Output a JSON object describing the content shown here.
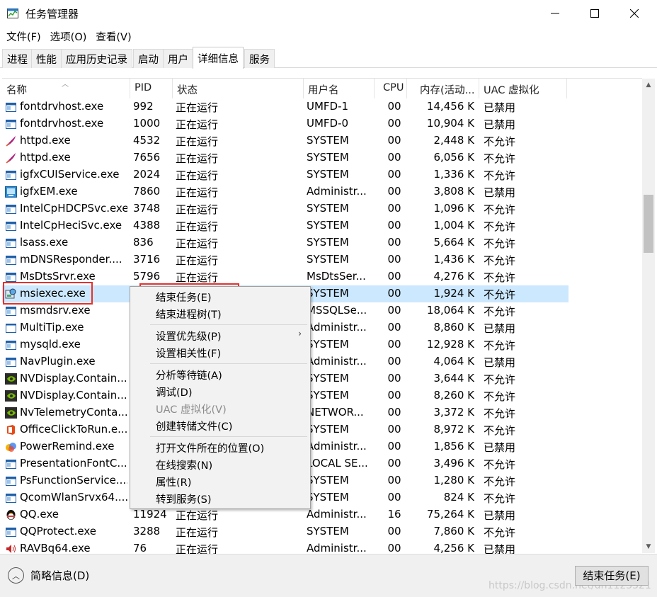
{
  "window": {
    "title": "任务管理器",
    "minimize_glyph": "—",
    "maximize_glyph": "☐",
    "close_glyph": "✕"
  },
  "menu": [
    "文件(F)",
    "选项(O)",
    "查看(V)"
  ],
  "tabs": [
    {
      "label": "进程",
      "active": false
    },
    {
      "label": "性能",
      "active": false
    },
    {
      "label": "应用历史记录",
      "active": false
    },
    {
      "label": "启动",
      "active": false
    },
    {
      "label": "用户",
      "active": false
    },
    {
      "label": "详细信息",
      "active": true
    },
    {
      "label": "服务",
      "active": false
    }
  ],
  "columns": {
    "name": "名称",
    "pid": "PID",
    "status": "状态",
    "user": "用户名",
    "cpu": "CPU",
    "memory": "内存(活动...",
    "uac": "UAC 虚拟化"
  },
  "rows": [
    {
      "name": "fontdrvhost.exe",
      "pid": "992",
      "status": "正在运行",
      "user": "UMFD-1",
      "cpu": "00",
      "memory": "14,456 K",
      "uac": "已禁用",
      "icon": "generic-window-icon"
    },
    {
      "name": "fontdrvhost.exe",
      "pid": "1000",
      "status": "正在运行",
      "user": "UMFD-0",
      "cpu": "00",
      "memory": "10,904 K",
      "uac": "已禁用",
      "icon": "generic-window-icon"
    },
    {
      "name": "httpd.exe",
      "pid": "4532",
      "status": "正在运行",
      "user": "SYSTEM",
      "cpu": "00",
      "memory": "2,448 K",
      "uac": "不允许",
      "icon": "apache-feather-icon"
    },
    {
      "name": "httpd.exe",
      "pid": "7656",
      "status": "正在运行",
      "user": "SYSTEM",
      "cpu": "00",
      "memory": "6,056 K",
      "uac": "不允许",
      "icon": "apache-feather-icon"
    },
    {
      "name": "igfxCUIService.exe",
      "pid": "2024",
      "status": "正在运行",
      "user": "SYSTEM",
      "cpu": "00",
      "memory": "1,336 K",
      "uac": "不允许",
      "icon": "generic-window-icon"
    },
    {
      "name": "igfxEM.exe",
      "pid": "7860",
      "status": "正在运行",
      "user": "Administr...",
      "cpu": "00",
      "memory": "3,808 K",
      "uac": "已禁用",
      "icon": "intel-graphics-icon"
    },
    {
      "name": "IntelCpHDCPSvc.exe",
      "pid": "3748",
      "status": "正在运行",
      "user": "SYSTEM",
      "cpu": "00",
      "memory": "1,096 K",
      "uac": "不允许",
      "icon": "generic-window-icon"
    },
    {
      "name": "IntelCpHeciSvc.exe",
      "pid": "4388",
      "status": "正在运行",
      "user": "SYSTEM",
      "cpu": "00",
      "memory": "1,004 K",
      "uac": "不允许",
      "icon": "generic-window-icon"
    },
    {
      "name": "lsass.exe",
      "pid": "836",
      "status": "正在运行",
      "user": "SYSTEM",
      "cpu": "00",
      "memory": "5,664 K",
      "uac": "不允许",
      "icon": "generic-window-icon"
    },
    {
      "name": "mDNSResponder....",
      "pid": "3716",
      "status": "正在运行",
      "user": "SYSTEM",
      "cpu": "00",
      "memory": "1,436 K",
      "uac": "不允许",
      "icon": "generic-window-icon"
    },
    {
      "name": "MsDtsSrvr.exe",
      "pid": "5796",
      "status": "正在运行",
      "user": "MsDtsSer...",
      "cpu": "00",
      "memory": "4,276 K",
      "uac": "不允许",
      "icon": "generic-window-icon"
    },
    {
      "name": "msiexec.exe",
      "pid": "",
      "status": "",
      "user": "SYSTEM",
      "cpu": "00",
      "memory": "1,924 K",
      "uac": "不允许",
      "icon": "installer-icon",
      "selected": true
    },
    {
      "name": "msmdsrv.exe",
      "pid": "",
      "status": "",
      "user": "MSSQLSe...",
      "cpu": "00",
      "memory": "18,064 K",
      "uac": "不允许",
      "icon": "generic-window-icon"
    },
    {
      "name": "MultiTip.exe",
      "pid": "",
      "status": "",
      "user": "Administr...",
      "cpu": "00",
      "memory": "8,860 K",
      "uac": "已禁用",
      "icon": "blank-window-icon"
    },
    {
      "name": "mysqld.exe",
      "pid": "",
      "status": "",
      "user": "SYSTEM",
      "cpu": "00",
      "memory": "12,928 K",
      "uac": "不允许",
      "icon": "generic-window-icon"
    },
    {
      "name": "NavPlugin.exe",
      "pid": "",
      "status": "",
      "user": "Administr...",
      "cpu": "00",
      "memory": "4,064 K",
      "uac": "已禁用",
      "icon": "generic-window-icon"
    },
    {
      "name": "NVDisplay.Contain...",
      "pid": "",
      "status": "",
      "user": "SYSTEM",
      "cpu": "00",
      "memory": "3,644 K",
      "uac": "不允许",
      "icon": "nvidia-icon"
    },
    {
      "name": "NVDisplay.Contain...",
      "pid": "",
      "status": "",
      "user": "SYSTEM",
      "cpu": "00",
      "memory": "8,260 K",
      "uac": "不允许",
      "icon": "nvidia-icon"
    },
    {
      "name": "NvTelemetryConta...",
      "pid": "",
      "status": "",
      "user": "NETWOR...",
      "cpu": "00",
      "memory": "3,372 K",
      "uac": "不允许",
      "icon": "nvidia-icon"
    },
    {
      "name": "OfficeClickToRun.e...",
      "pid": "",
      "status": "",
      "user": "SYSTEM",
      "cpu": "00",
      "memory": "8,972 K",
      "uac": "不允许",
      "icon": "office-icon"
    },
    {
      "name": "PowerRemind.exe",
      "pid": "",
      "status": "",
      "user": "Administr...",
      "cpu": "00",
      "memory": "1,856 K",
      "uac": "已禁用",
      "icon": "power-remind-icon"
    },
    {
      "name": "PresentationFontC...",
      "pid": "",
      "status": "",
      "user": "LOCAL SE...",
      "cpu": "00",
      "memory": "3,496 K",
      "uac": "不允许",
      "icon": "generic-window-icon"
    },
    {
      "name": "PsFunctionService....",
      "pid": "",
      "status": "",
      "user": "SYSTEM",
      "cpu": "00",
      "memory": "1,280 K",
      "uac": "不允许",
      "icon": "generic-window-icon"
    },
    {
      "name": "QcomWlanSrvx64....",
      "pid": "",
      "status": "",
      "user": "SYSTEM",
      "cpu": "00",
      "memory": "824 K",
      "uac": "不允许",
      "icon": "generic-window-icon"
    },
    {
      "name": "QQ.exe",
      "pid": "11924",
      "status": "正在运行",
      "user": "Administr...",
      "cpu": "16",
      "memory": "75,264 K",
      "uac": "已禁用",
      "icon": "qq-penguin-icon"
    },
    {
      "name": "QQProtect.exe",
      "pid": "3288",
      "status": "正在运行",
      "user": "SYSTEM",
      "cpu": "00",
      "memory": "7,860 K",
      "uac": "不允许",
      "icon": "generic-window-icon"
    },
    {
      "name": "RAVBq64.exe",
      "pid": "76",
      "status": "正在运行",
      "user": "Administr...",
      "cpu": "00",
      "memory": "4,256 K",
      "uac": "已禁用",
      "icon": "speaker-icon"
    }
  ],
  "context_menu": {
    "groups": [
      [
        {
          "label": "结束任务(E)",
          "disabled": false
        },
        {
          "label": "结束进程树(T)",
          "disabled": false
        }
      ],
      [
        {
          "label": "设置优先级(P)",
          "disabled": false,
          "submenu": true
        },
        {
          "label": "设置相关性(F)",
          "disabled": false
        }
      ],
      [
        {
          "label": "分析等待链(A)",
          "disabled": false
        },
        {
          "label": "调试(D)",
          "disabled": false
        },
        {
          "label": "UAC 虚拟化(V)",
          "disabled": true
        },
        {
          "label": "创建转储文件(C)",
          "disabled": false
        }
      ],
      [
        {
          "label": "打开文件所在的位置(O)",
          "disabled": false
        },
        {
          "label": "在线搜索(N)",
          "disabled": false
        },
        {
          "label": "属性(R)",
          "disabled": false
        },
        {
          "label": "转到服务(S)",
          "disabled": false
        }
      ]
    ],
    "submenu_arrow": "›"
  },
  "footer": {
    "fewer_details": "简略信息(D)",
    "end_task": "结束任务(E)",
    "watermark": "https://blog.csdn.net/dh1123321"
  },
  "colors": {
    "selection": "#cce8ff",
    "highlight_box": "#e8302e",
    "menu_bg": "#f2f2f2"
  }
}
